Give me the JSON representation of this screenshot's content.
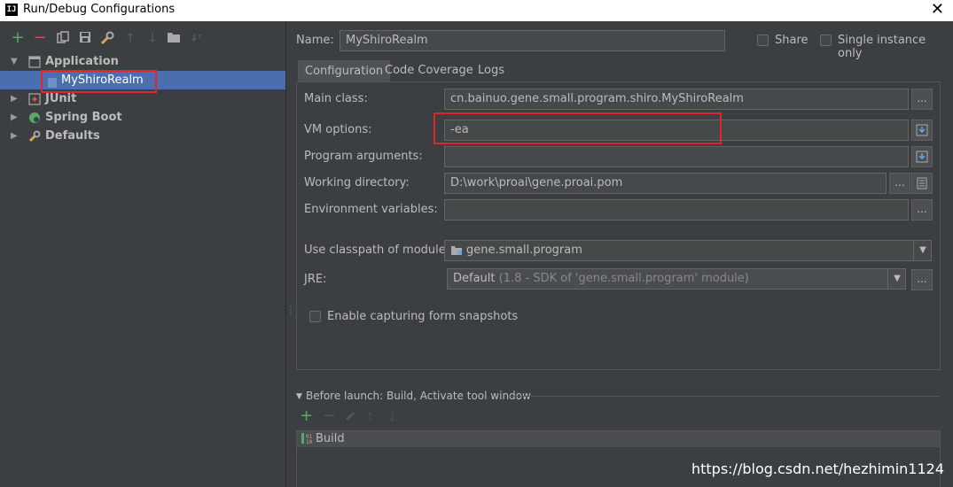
{
  "window": {
    "title": "Run/Debug Configurations",
    "logo_text": "IJ",
    "close_glyph": "✕"
  },
  "toolbar": {
    "icons": [
      "add-icon",
      "remove-icon",
      "copy-icon",
      "save-icon",
      "wrench-icon",
      "move-up-icon",
      "move-down-icon",
      "folder-icon",
      "sort-icon"
    ]
  },
  "tree": {
    "application": "Application",
    "myshirorealm": "MyShiroRealm",
    "junit": "JUnit",
    "spring_boot": "Spring Boot",
    "defaults": "Defaults"
  },
  "header": {
    "name_label": "Name:",
    "name_value": "MyShiroRealm",
    "share_label": "Share",
    "single_instance_label": "Single instance only"
  },
  "tabs": [
    "Configuration",
    "Code Coverage",
    "Logs"
  ],
  "form": {
    "main_class_label": "Main class:",
    "main_class_value": "cn.bainuo.gene.small.program.shiro.MyShiroRealm",
    "vm_options_label": "VM options:",
    "vm_options_value": "-ea",
    "program_args_label": "Program arguments:",
    "program_args_value": "",
    "working_dir_label": "Working directory:",
    "working_dir_value": "D:\\work\\proai\\gene.proai.pom",
    "env_vars_label": "Environment variables:",
    "env_vars_value": "",
    "classpath_label": "Use classpath of module:",
    "classpath_value": "gene.small.program",
    "jre_label": "JRE:",
    "jre_value": "Default",
    "jre_detail": "(1.8 - SDK of 'gene.small.program' module)",
    "snapshots_label": "Enable capturing form snapshots",
    "ellipsis": "...",
    "dropdown_arrow": "▼"
  },
  "before_launch": {
    "title": "Before launch: Build, Activate tool window",
    "toolbar_icons": [
      "add-icon",
      "remove-icon",
      "edit-icon",
      "move-up-icon",
      "move-down-icon"
    ],
    "items": [
      "Build"
    ]
  },
  "watermark": "https://blog.csdn.net/hezhimin1124",
  "colors": {
    "background": "#3c3f41",
    "selection": "#4b6eaf",
    "highlight_box": "#e0262b",
    "add_green": "#59a869",
    "remove_red": "#c75450"
  }
}
